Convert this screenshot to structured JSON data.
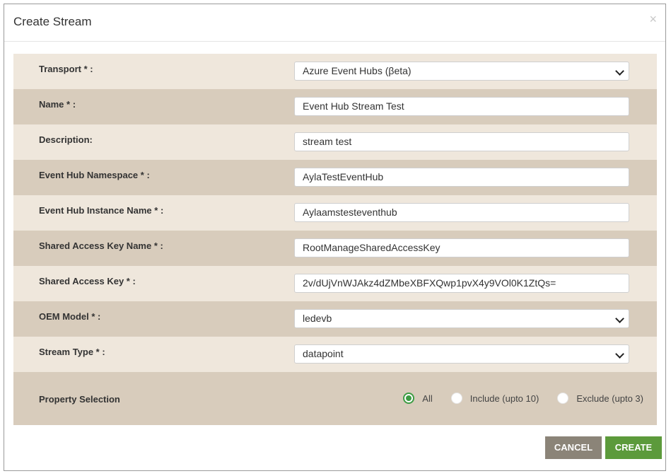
{
  "modal": {
    "title": "Create Stream",
    "close_symbol": "×"
  },
  "fields": [
    {
      "label": "Transport * :",
      "value": "Azure Event Hubs (βeta)",
      "type": "select"
    },
    {
      "label": "Name * :",
      "value": "Event Hub Stream Test",
      "type": "input"
    },
    {
      "label": "Description:",
      "value": "stream test",
      "type": "input"
    },
    {
      "label": "Event Hub Namespace * :",
      "value": "AylaTestEventHub",
      "type": "input"
    },
    {
      "label": "Event Hub Instance Name * :",
      "value": "Aylaamstesteventhub",
      "type": "input"
    },
    {
      "label": "Shared Access Key Name * :",
      "value": "RootManageSharedAccessKey",
      "type": "input"
    },
    {
      "label": "Shared Access Key * :",
      "value": "2v/dUjVnWJAkz4dZMbeXBFXQwp1pvX4y9VOl0K1ZtQs=",
      "type": "input"
    },
    {
      "label": "OEM Model * :",
      "value": "ledevb",
      "type": "select"
    },
    {
      "label": "Stream Type * :",
      "value": "datapoint",
      "type": "select"
    }
  ],
  "property_selection": {
    "label": "Property Selection",
    "options": [
      {
        "label": "All",
        "checked": true
      },
      {
        "label": "Include (upto 10)",
        "checked": false
      },
      {
        "label": "Exclude (upto 3)",
        "checked": false
      }
    ]
  },
  "buttons": {
    "cancel": "CANCEL",
    "create": "CREATE"
  },
  "colors": {
    "row_light": "#efe7dc",
    "row_dark": "#d8ccbc",
    "cancel_bg": "#8b8478",
    "create_bg": "#5c9a3b",
    "radio_checked": "#3d9c43"
  },
  "icons": {
    "close": "close-icon",
    "select_arrow": "chevron-down-icon",
    "radio": "radio-icon"
  }
}
